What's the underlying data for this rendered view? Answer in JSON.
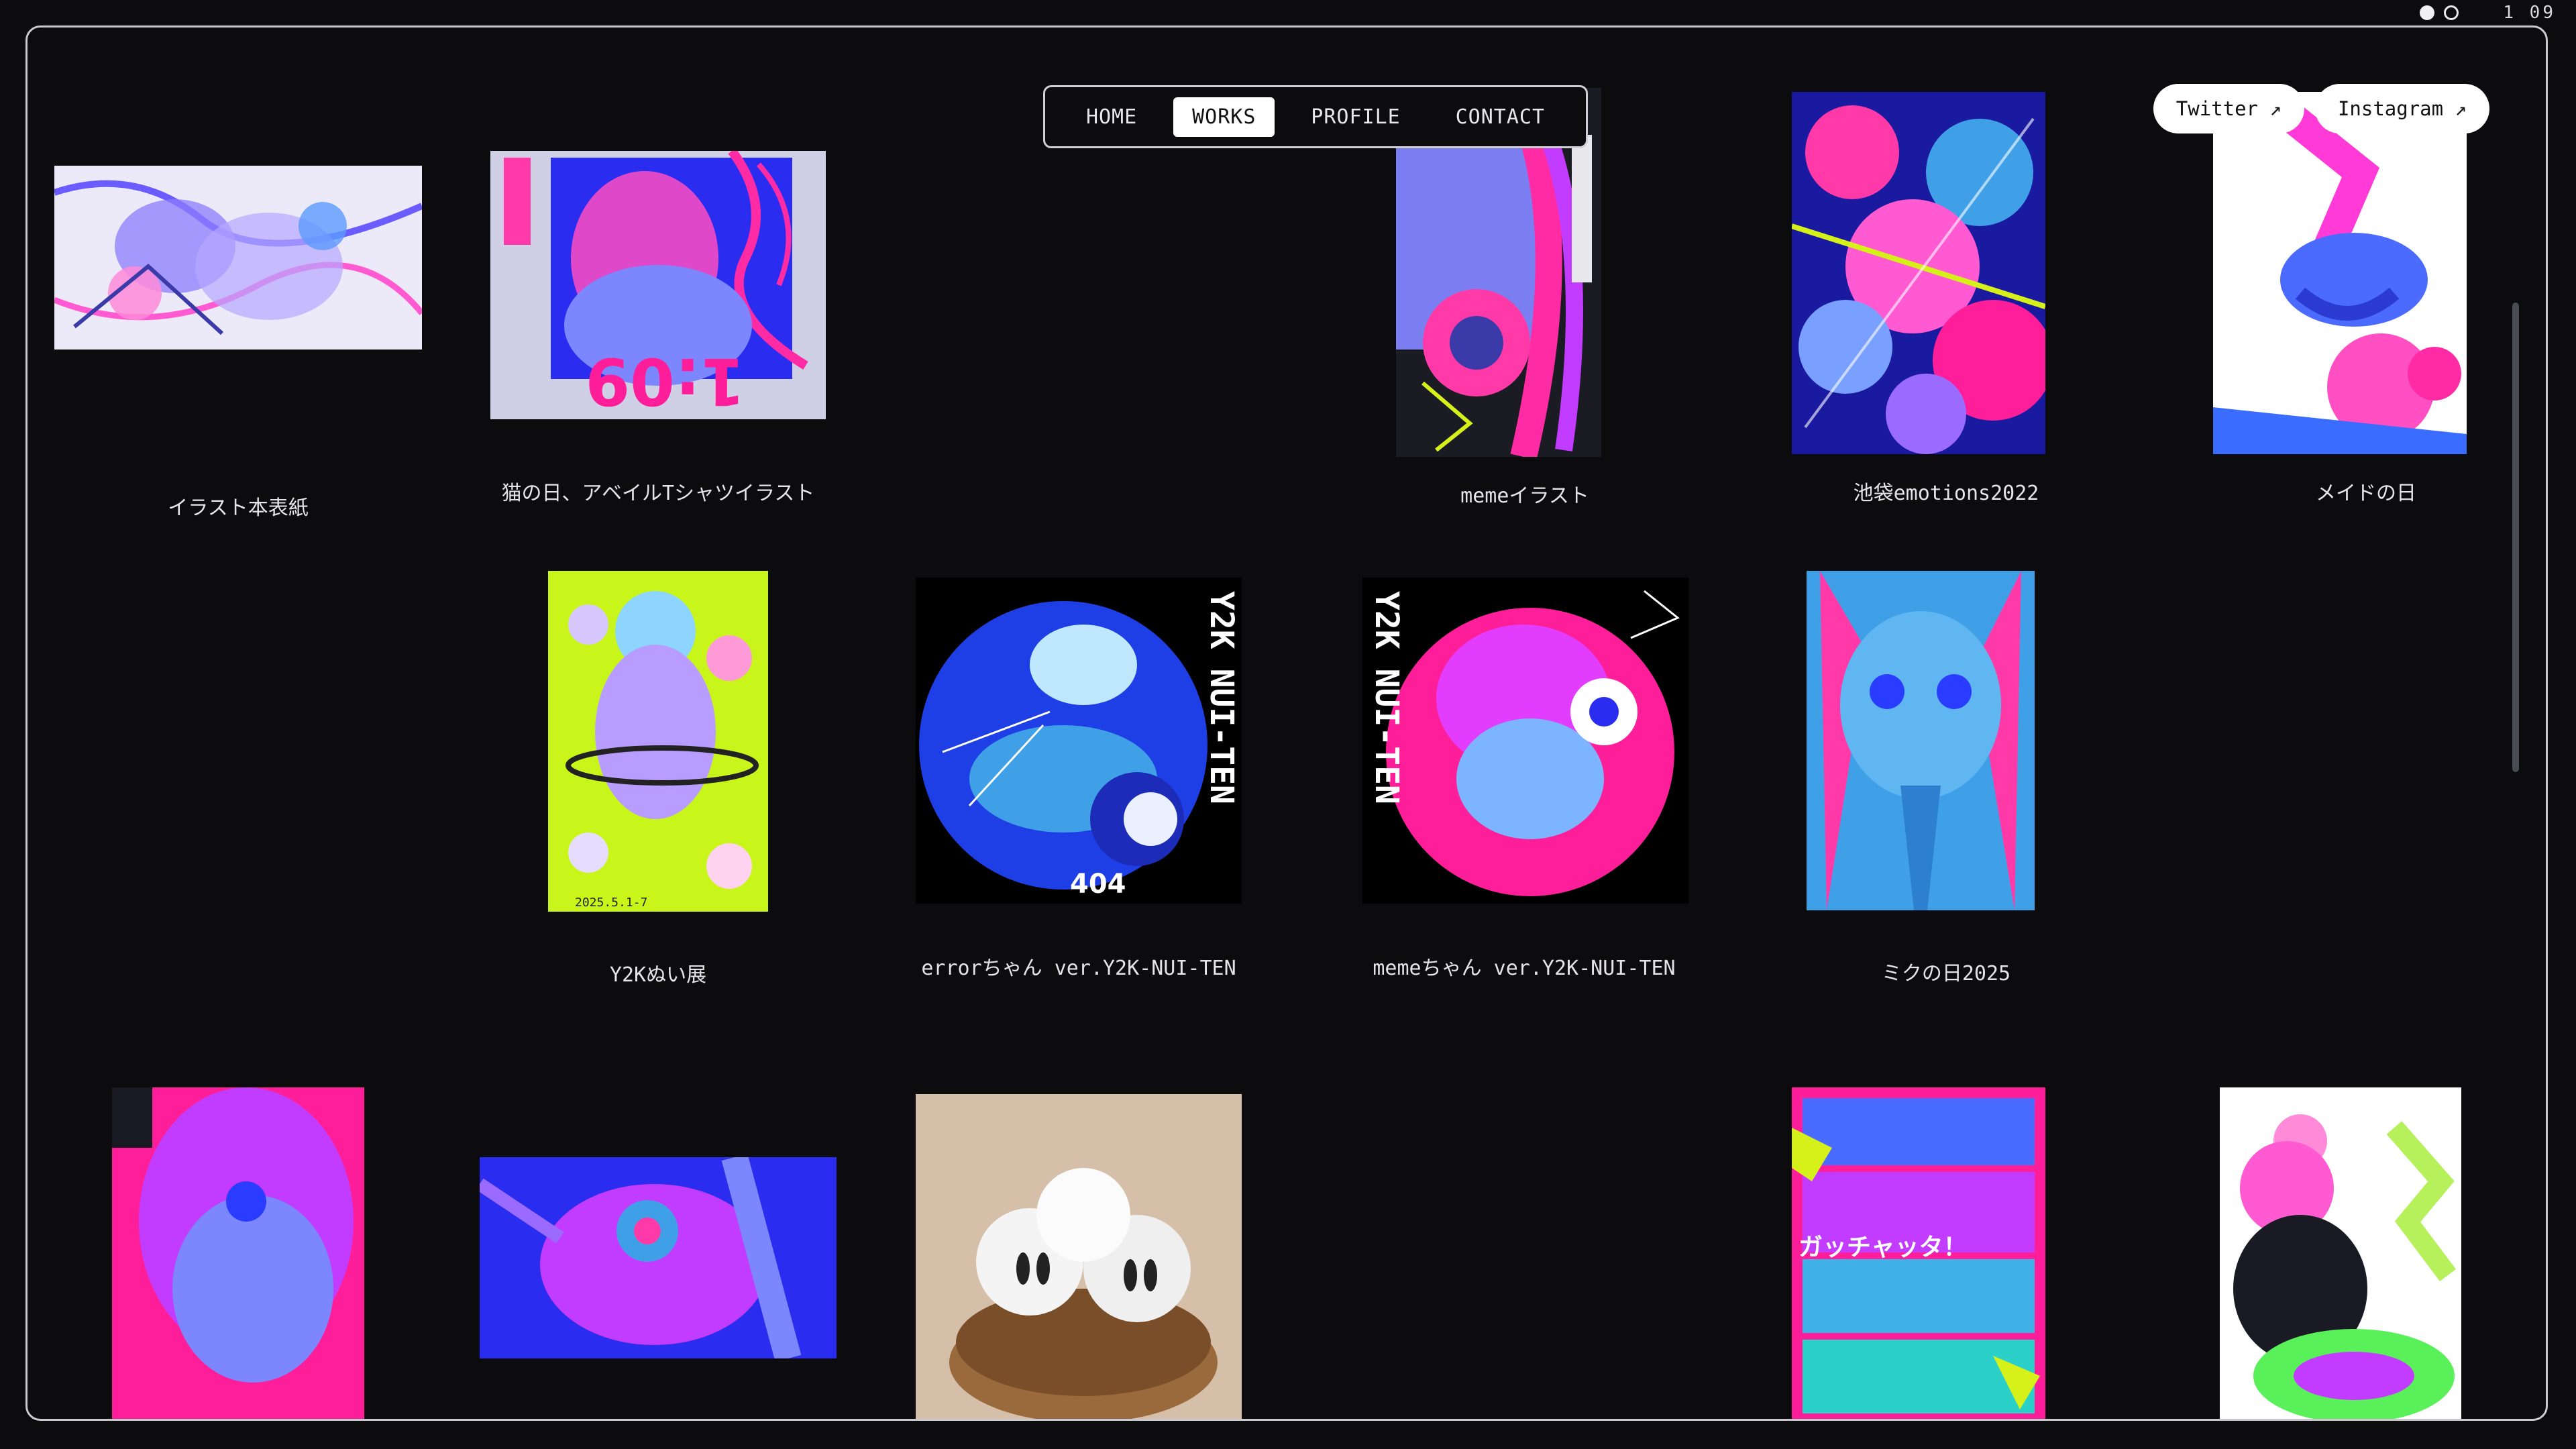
{
  "status": {
    "counter": "1 09"
  },
  "nav": {
    "items": [
      "HOME",
      "WORKS",
      "PROFILE",
      "CONTACT"
    ],
    "active": "WORKS"
  },
  "social": {
    "twitter": "Twitter ↗",
    "instagram": "Instagram ↗"
  },
  "works": [
    {
      "title": "イラスト本表紙"
    },
    {
      "title": "猫の日、アベイルTシャツイラスト"
    },
    {
      "title": "memeイラスト"
    },
    {
      "title": "池袋emotions2022"
    },
    {
      "title": "メイドの日"
    },
    {
      "title": "Y2Kぬい展"
    },
    {
      "title": "errorちゃん ver.Y2K-NUI-TEN"
    },
    {
      "title": "memeちゃん ver.Y2K-NUI-TEN"
    },
    {
      "title": "ミクの日2025"
    }
  ],
  "art_text": {
    "cat_day": "1:09",
    "y2k_label": "Y2K NUI-TEN",
    "error_tag": "404",
    "poster_date": "2025.5.1-7",
    "manga_sfx": "ガッチャッタ！"
  },
  "colors": {
    "background": "#0c0c0f",
    "border": "#c9c9cf",
    "pink": "#ff1e9a",
    "blue": "#2a3cff",
    "lime": "#c8f51a",
    "sky": "#3fa0e8"
  }
}
